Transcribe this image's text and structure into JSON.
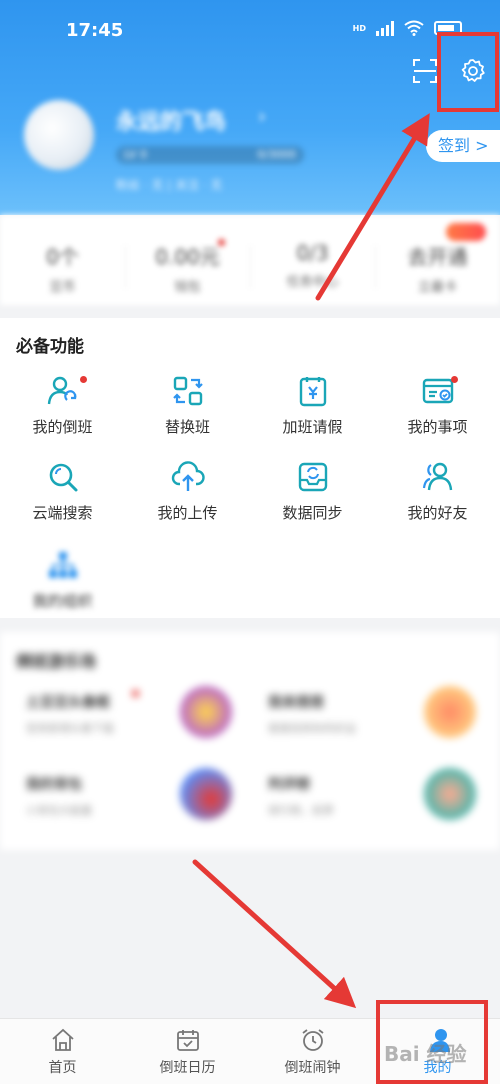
{
  "status": {
    "time": "17:45",
    "network": "HD"
  },
  "header": {
    "username": "永远的飞鸟",
    "level": "LV 0",
    "exp": "0/3000",
    "level_progress": 0.0,
    "meta": "粉丝 · 无  |  关注 · 无",
    "signin": "签到",
    "signin_chevron": ">"
  },
  "stats": [
    {
      "value": "0个",
      "label": "豆币"
    },
    {
      "value": "0.00元",
      "label": "钱包"
    },
    {
      "value": "0/3",
      "label": "任务中心"
    },
    {
      "value": "去开通",
      "label": "立最卡"
    }
  ],
  "features": {
    "title": "必备功能",
    "items": [
      {
        "label": "我的倒班",
        "icon": "user-sync-icon"
      },
      {
        "label": "替换班",
        "icon": "swap-icon"
      },
      {
        "label": "加班请假",
        "icon": "clipboard-yen-icon"
      },
      {
        "label": "我的事项",
        "icon": "card-check-icon"
      },
      {
        "label": "云端搜索",
        "icon": "search-icon"
      },
      {
        "label": "我的上传",
        "icon": "cloud-upload-icon"
      },
      {
        "label": "数据同步",
        "icon": "inbox-sync-icon"
      },
      {
        "label": "我的好友",
        "icon": "friends-icon"
      },
      {
        "label": "我的组织",
        "icon": "org-icon"
      }
    ]
  },
  "games": {
    "title": "倒班游乐场",
    "items": [
      {
        "name": "土豆豆头像框",
        "desc": "签到获得头像下载"
      },
      {
        "name": "我来搭搭",
        "desc": "搭搭找到你的好运"
      },
      {
        "name": "我的背包",
        "desc": "小背包大能量"
      },
      {
        "name": "判评榜",
        "desc": "排行榜，前茅"
      }
    ]
  },
  "tabs": [
    {
      "label": "首页",
      "icon": "home-icon"
    },
    {
      "label": "倒班日历",
      "icon": "calendar-icon"
    },
    {
      "label": "倒班闹钟",
      "icon": "alarm-clock-icon"
    },
    {
      "label": "我的",
      "icon": "profile-icon"
    }
  ],
  "watermark": "Bai 经验",
  "colors": {
    "accent": "#2f95ef",
    "teal": "#1aa6b7",
    "annotation": "#e53935"
  }
}
